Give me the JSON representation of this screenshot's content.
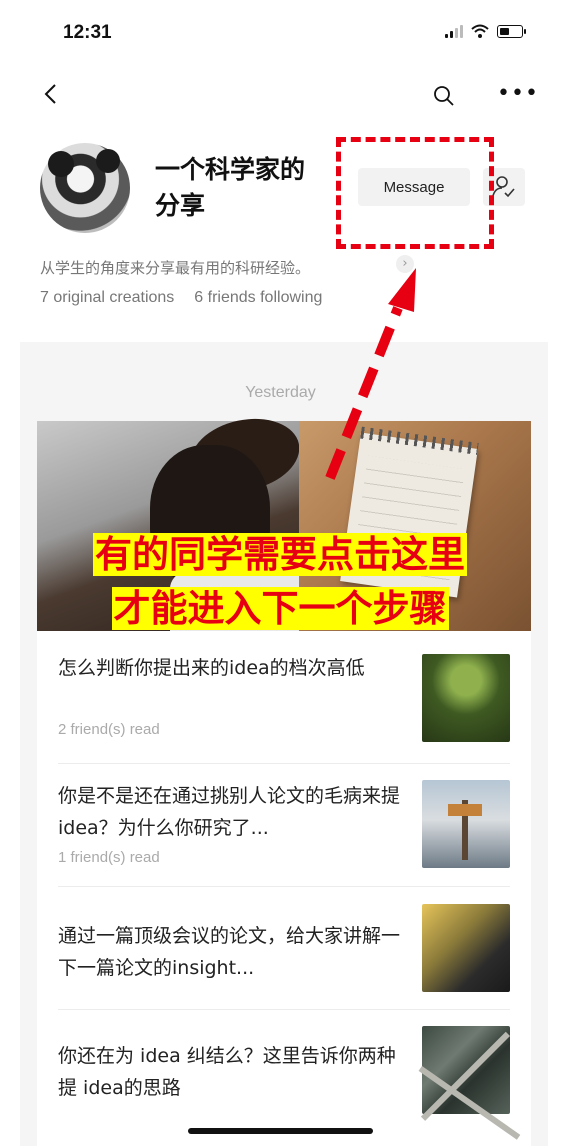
{
  "status_bar": {
    "time": "12:31"
  },
  "profile": {
    "name": "一个科学家的分享",
    "message_label": "Message",
    "bio": "从学生的角度来分享最有用的科研经验。",
    "original_creations": "7 original creations",
    "friends_following": "6 friends following"
  },
  "feed": {
    "day_label": "Yesterday",
    "overlay_caption": [
      "有的同学需要点击这里",
      "才能进入下一个步骤"
    ],
    "articles": [
      {
        "title": "怎么判断你提出来的idea的档次高低",
        "meta": "2 friend(s) read"
      },
      {
        "title": "你是不是还在通过挑别人论文的毛病来提 idea？为什么你研究了...",
        "meta": "1 friend(s) read"
      },
      {
        "title": "通过一篇顶级会议的论文，给大家讲解一下一篇论文的insight...",
        "meta": ""
      },
      {
        "title": "你还在为 idea 纠结么？这里告诉你两种提 idea的思路",
        "meta": ""
      }
    ]
  },
  "colors": {
    "annotation_red": "#e60012",
    "caption_bg": "#ffff00"
  },
  "icons": [
    "back-icon",
    "search-icon",
    "more-icon",
    "follow-icon",
    "chevron-right-icon"
  ]
}
